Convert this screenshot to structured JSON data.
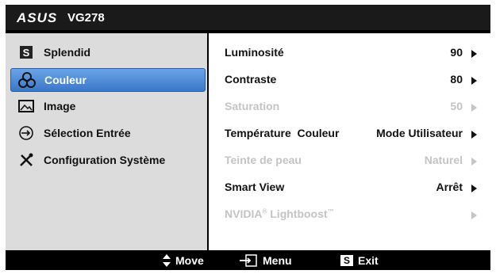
{
  "brand": "ASUS",
  "model": "VG278",
  "menu": {
    "items": [
      {
        "label": "Splendid",
        "icon": "splendid-s-icon"
      },
      {
        "label": "Couleur",
        "icon": "color-circles-icon",
        "active": true
      },
      {
        "label": "Image",
        "icon": "image-icon"
      },
      {
        "label": "Sélection Entrée",
        "icon": "input-select-icon"
      },
      {
        "label": "Configuration Système",
        "icon": "tools-icon"
      }
    ]
  },
  "settings": {
    "rows": [
      {
        "label": "Luminosité",
        "value": "90",
        "enabled": true
      },
      {
        "label": "Contraste",
        "value": "80",
        "enabled": true
      },
      {
        "label": "Saturation",
        "value": "50",
        "enabled": false
      },
      {
        "label": "Température  Couleur",
        "value": "Mode Utilisateur",
        "enabled": true
      },
      {
        "label": "Teinte de peau",
        "value": "Naturel",
        "enabled": false
      },
      {
        "label": "Smart View",
        "value": "Arrêt",
        "enabled": true
      },
      {
        "label_main": "NVIDIA",
        "label_sup1": "®",
        "label_rest": " Lightboost",
        "label_sup2": "™",
        "value": "",
        "enabled": false
      }
    ]
  },
  "footer": {
    "move_label": "Move",
    "menu_label": "Menu",
    "exit_key": "S",
    "exit_label": "Exit"
  },
  "colors": {
    "active_item": "#4a87d8",
    "disabled_text": "#c4c4c4"
  }
}
